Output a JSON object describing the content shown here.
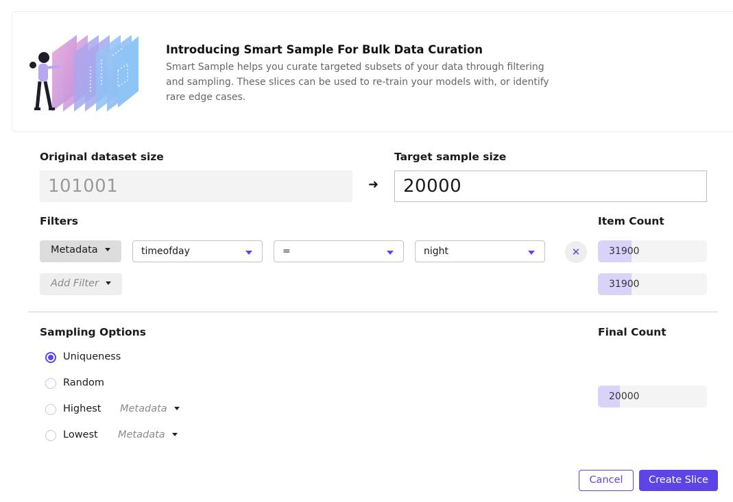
{
  "banner": {
    "title": "Introducing Smart Sample For Bulk Data Curation",
    "description": "Smart Sample helps you curate targeted subsets of your data through filtering and sampling. These slices can be used to re-train your models with, or identify rare edge cases."
  },
  "sizes": {
    "original_label": "Original dataset size",
    "original_value": "101001",
    "target_label": "Target sample size",
    "target_value": "20000"
  },
  "filters": {
    "label": "Filters",
    "item_count_label": "Item Count",
    "rows": [
      {
        "type": "Metadata",
        "field": "timeofday",
        "operator": "=",
        "value": "night",
        "count": "31900",
        "count_fraction": 0.31
      }
    ],
    "add_filter_label": "Add Filter",
    "total_count": "31900",
    "total_fraction": 0.31
  },
  "sampling": {
    "label": "Sampling Options",
    "final_count_label": "Final Count",
    "options": [
      {
        "label": "Uniqueness",
        "selected": true
      },
      {
        "label": "Random",
        "selected": false
      },
      {
        "label": "Highest",
        "selected": false,
        "metadata": "Metadata"
      },
      {
        "label": "Lowest",
        "selected": false,
        "metadata": "Metadata"
      }
    ],
    "final_count": "20000",
    "final_fraction": 0.2
  },
  "actions": {
    "cancel": "Cancel",
    "create": "Create Slice"
  },
  "colors": {
    "accent": "#5b45e6",
    "count_fill": "#d9d3fa"
  }
}
